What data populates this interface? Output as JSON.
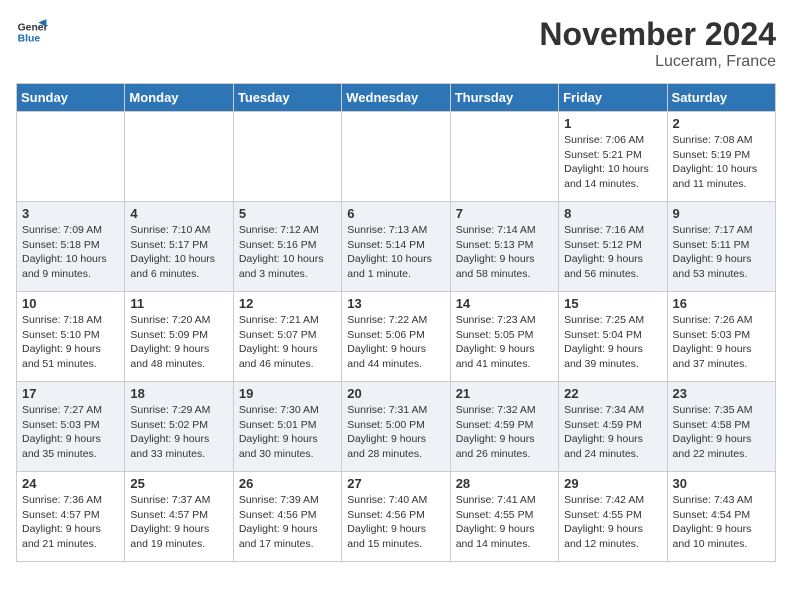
{
  "logo": {
    "line1": "General",
    "line2": "Blue"
  },
  "title": "November 2024",
  "location": "Luceram, France",
  "weekdays": [
    "Sunday",
    "Monday",
    "Tuesday",
    "Wednesday",
    "Thursday",
    "Friday",
    "Saturday"
  ],
  "weeks": [
    [
      {
        "day": "",
        "info": ""
      },
      {
        "day": "",
        "info": ""
      },
      {
        "day": "",
        "info": ""
      },
      {
        "day": "",
        "info": ""
      },
      {
        "day": "",
        "info": ""
      },
      {
        "day": "1",
        "info": "Sunrise: 7:06 AM\nSunset: 5:21 PM\nDaylight: 10 hours\nand 14 minutes."
      },
      {
        "day": "2",
        "info": "Sunrise: 7:08 AM\nSunset: 5:19 PM\nDaylight: 10 hours\nand 11 minutes."
      }
    ],
    [
      {
        "day": "3",
        "info": "Sunrise: 7:09 AM\nSunset: 5:18 PM\nDaylight: 10 hours\nand 9 minutes."
      },
      {
        "day": "4",
        "info": "Sunrise: 7:10 AM\nSunset: 5:17 PM\nDaylight: 10 hours\nand 6 minutes."
      },
      {
        "day": "5",
        "info": "Sunrise: 7:12 AM\nSunset: 5:16 PM\nDaylight: 10 hours\nand 3 minutes."
      },
      {
        "day": "6",
        "info": "Sunrise: 7:13 AM\nSunset: 5:14 PM\nDaylight: 10 hours\nand 1 minute."
      },
      {
        "day": "7",
        "info": "Sunrise: 7:14 AM\nSunset: 5:13 PM\nDaylight: 9 hours\nand 58 minutes."
      },
      {
        "day": "8",
        "info": "Sunrise: 7:16 AM\nSunset: 5:12 PM\nDaylight: 9 hours\nand 56 minutes."
      },
      {
        "day": "9",
        "info": "Sunrise: 7:17 AM\nSunset: 5:11 PM\nDaylight: 9 hours\nand 53 minutes."
      }
    ],
    [
      {
        "day": "10",
        "info": "Sunrise: 7:18 AM\nSunset: 5:10 PM\nDaylight: 9 hours\nand 51 minutes."
      },
      {
        "day": "11",
        "info": "Sunrise: 7:20 AM\nSunset: 5:09 PM\nDaylight: 9 hours\nand 48 minutes."
      },
      {
        "day": "12",
        "info": "Sunrise: 7:21 AM\nSunset: 5:07 PM\nDaylight: 9 hours\nand 46 minutes."
      },
      {
        "day": "13",
        "info": "Sunrise: 7:22 AM\nSunset: 5:06 PM\nDaylight: 9 hours\nand 44 minutes."
      },
      {
        "day": "14",
        "info": "Sunrise: 7:23 AM\nSunset: 5:05 PM\nDaylight: 9 hours\nand 41 minutes."
      },
      {
        "day": "15",
        "info": "Sunrise: 7:25 AM\nSunset: 5:04 PM\nDaylight: 9 hours\nand 39 minutes."
      },
      {
        "day": "16",
        "info": "Sunrise: 7:26 AM\nSunset: 5:03 PM\nDaylight: 9 hours\nand 37 minutes."
      }
    ],
    [
      {
        "day": "17",
        "info": "Sunrise: 7:27 AM\nSunset: 5:03 PM\nDaylight: 9 hours\nand 35 minutes."
      },
      {
        "day": "18",
        "info": "Sunrise: 7:29 AM\nSunset: 5:02 PM\nDaylight: 9 hours\nand 33 minutes."
      },
      {
        "day": "19",
        "info": "Sunrise: 7:30 AM\nSunset: 5:01 PM\nDaylight: 9 hours\nand 30 minutes."
      },
      {
        "day": "20",
        "info": "Sunrise: 7:31 AM\nSunset: 5:00 PM\nDaylight: 9 hours\nand 28 minutes."
      },
      {
        "day": "21",
        "info": "Sunrise: 7:32 AM\nSunset: 4:59 PM\nDaylight: 9 hours\nand 26 minutes."
      },
      {
        "day": "22",
        "info": "Sunrise: 7:34 AM\nSunset: 4:59 PM\nDaylight: 9 hours\nand 24 minutes."
      },
      {
        "day": "23",
        "info": "Sunrise: 7:35 AM\nSunset: 4:58 PM\nDaylight: 9 hours\nand 22 minutes."
      }
    ],
    [
      {
        "day": "24",
        "info": "Sunrise: 7:36 AM\nSunset: 4:57 PM\nDaylight: 9 hours\nand 21 minutes."
      },
      {
        "day": "25",
        "info": "Sunrise: 7:37 AM\nSunset: 4:57 PM\nDaylight: 9 hours\nand 19 minutes."
      },
      {
        "day": "26",
        "info": "Sunrise: 7:39 AM\nSunset: 4:56 PM\nDaylight: 9 hours\nand 17 minutes."
      },
      {
        "day": "27",
        "info": "Sunrise: 7:40 AM\nSunset: 4:56 PM\nDaylight: 9 hours\nand 15 minutes."
      },
      {
        "day": "28",
        "info": "Sunrise: 7:41 AM\nSunset: 4:55 PM\nDaylight: 9 hours\nand 14 minutes."
      },
      {
        "day": "29",
        "info": "Sunrise: 7:42 AM\nSunset: 4:55 PM\nDaylight: 9 hours\nand 12 minutes."
      },
      {
        "day": "30",
        "info": "Sunrise: 7:43 AM\nSunset: 4:54 PM\nDaylight: 9 hours\nand 10 minutes."
      }
    ]
  ]
}
